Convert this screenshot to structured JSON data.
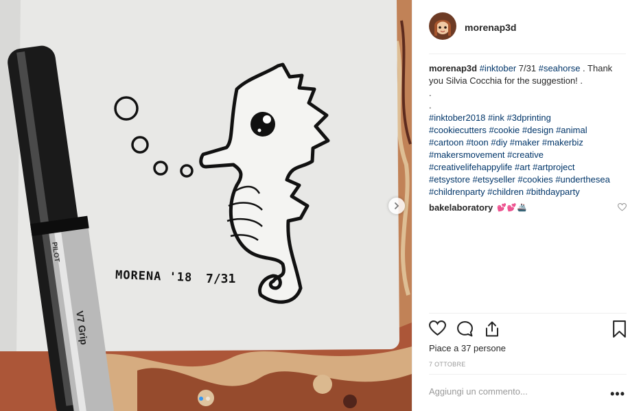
{
  "post": {
    "username": "morenap3d",
    "caption": {
      "username": "morenap3d",
      "line1_tags": [
        "#inktober",
        "#seahorse"
      ],
      "line1_text_a": " 7/31 ",
      "line1_text_b": " . Thank",
      "line2": "you Silvia Cocchia for the suggestion! .",
      "dot1": ".",
      "dot2": ".",
      "tag_lines": [
        [
          "#inktober2018",
          "#ink",
          "#3dprinting"
        ],
        [
          "#cookiecutters",
          "#cookie",
          "#design",
          "#animal"
        ],
        [
          "#cartoon",
          "#toon",
          "#diy",
          "#maker",
          "#makerbiz"
        ],
        [
          "#makersmovement",
          "#creative"
        ],
        [
          "#creativelifehappylife",
          "#art",
          "#artproject"
        ],
        [
          "#etsystore",
          "#etsyseller",
          "#cookies",
          "#underthesea"
        ],
        [
          "#childrenparty",
          "#children",
          "#bithdayparty"
        ]
      ]
    },
    "comment": {
      "username": "bakelaboratory",
      "emojis": "💕💕🚢"
    },
    "likes_text": "Piace a 37 persone",
    "date": "7 ottobre",
    "add_comment_placeholder": "Aggiungi un commento...",
    "more_label": "•••"
  },
  "photo": {
    "signature": "MORENA '18",
    "day": "7/31",
    "pen_brand": "PILOT",
    "pen_model": "V7 Grip",
    "slides_total": 2,
    "slide_active": 1
  },
  "colors": {
    "hashtag": "#003569",
    "text": "#262626",
    "muted": "#999999",
    "divider": "#efefef",
    "dot_active": "#3897f0"
  }
}
